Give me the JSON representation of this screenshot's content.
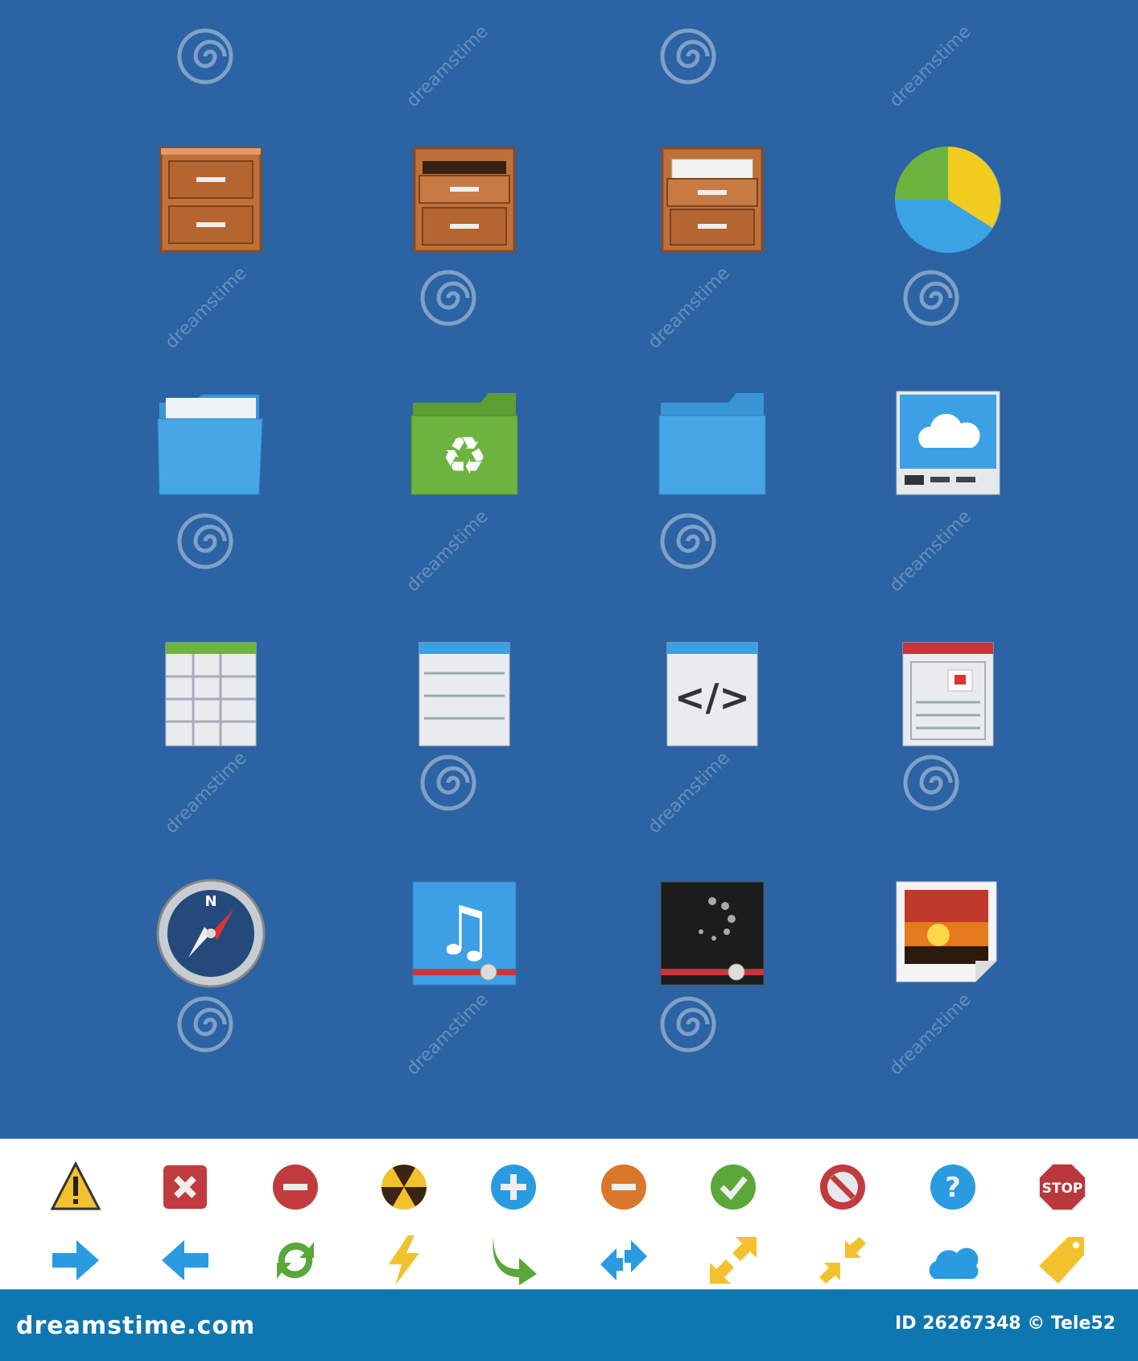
{
  "watermark": "dreamstime",
  "icons": [
    "file-cabinet-closed",
    "file-cabinet-open",
    "file-cabinet-documents",
    "pie-chart",
    "folder-documents",
    "folder-recycle",
    "folder",
    "cloud-server",
    "spreadsheet-document",
    "text-document",
    "code-document",
    "web-page-document",
    "compass-browser",
    "music-player",
    "video-loading",
    "image-photo"
  ],
  "small_icons_row1": [
    "warning",
    "close",
    "remove-red",
    "radiation",
    "add",
    "remove-orange",
    "ok",
    "forbidden",
    "help",
    "stop"
  ],
  "small_icons_row2": [
    "arrow-right",
    "arrow-left",
    "refresh",
    "lightning",
    "redo",
    "transfer",
    "expand",
    "collapse",
    "cloud",
    "tag"
  ],
  "stop_label": "STOP",
  "compass_label": "N",
  "code_label": "</>",
  "footer": {
    "logo": "dreamstime.com",
    "credit": "ID 26267348 © Tele52"
  },
  "colors": {
    "background": "#2b63a4",
    "footer": "#0f77b0",
    "wood": "#c0713a"
  }
}
